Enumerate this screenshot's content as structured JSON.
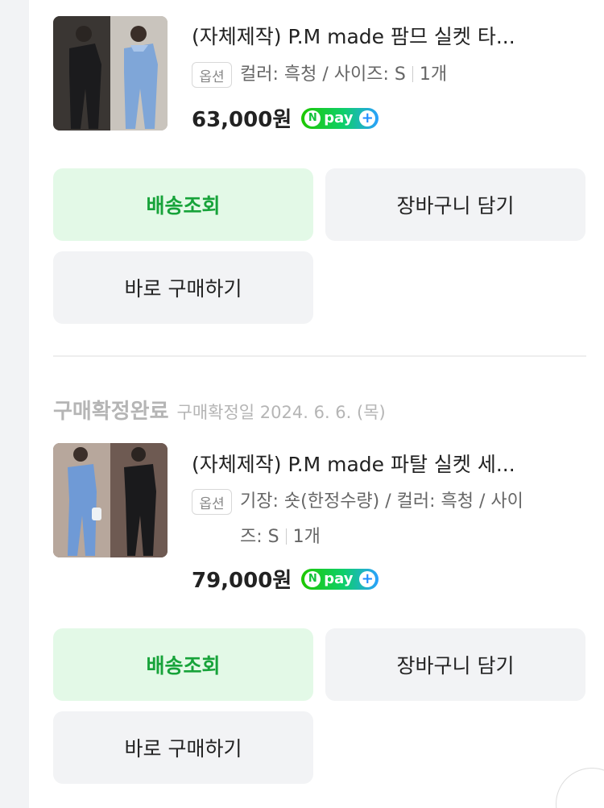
{
  "orders": [
    {
      "title": "(자체제작) P.M made 팜므 실켓 타...",
      "option_badge": "옵션",
      "option_main": "컬러: 흑청 / 사이즈: S",
      "option_qty": "1개",
      "price": "63,000원",
      "npay": {
        "n": "N",
        "label": "pay",
        "plus": "+"
      },
      "buttons": {
        "track": "배송조회",
        "cart": "장바구니 담기",
        "buy": "바로 구매하기"
      },
      "image": "product-photo-jumpsuit-black-and-blue"
    },
    {
      "status_label": "구매확정완료",
      "status_date": "구매확정일 2024. 6. 6. (목)",
      "title": "(자체제작) P.M made 파탈 실켓 세...",
      "option_badge": "옵션",
      "option_line1": "기장: 숏(한정수량) / 컬러: 흑청 / 사이",
      "option_line2": "즈: S",
      "option_qty": "1개",
      "price": "79,000원",
      "npay": {
        "n": "N",
        "label": "pay",
        "plus": "+"
      },
      "buttons": {
        "track": "배송조회",
        "cart": "장바구니 담기",
        "buy": "바로 구매하기"
      },
      "image": "product-photo-setup-blue-and-black"
    }
  ],
  "colors": {
    "green_button_bg": "#e3f9e7",
    "green_button_text": "#17a33a",
    "gray_button_bg": "#f2f3f5",
    "status_gray": "#b5b5b5",
    "npay_green": "#1ec800"
  }
}
